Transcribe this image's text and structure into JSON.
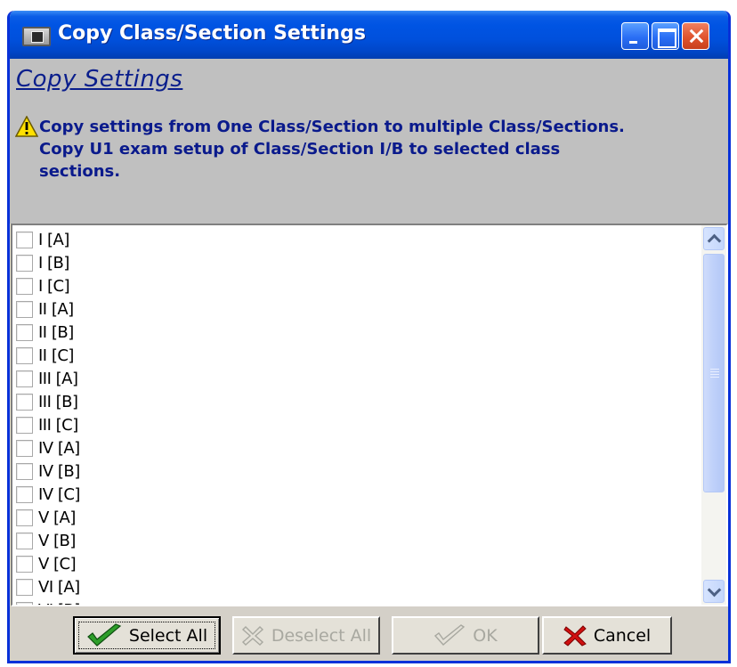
{
  "window": {
    "title": "Copy Class/Section Settings"
  },
  "header": {
    "heading": "Copy Settings",
    "message_lines": [
      "Copy settings from One Class/Section to multiple Class/Sections.",
      "Copy U1 exam setup of Class/Section I/B to selected class",
      "sections."
    ]
  },
  "list": {
    "items": [
      {
        "label": "I [A]",
        "checked": false
      },
      {
        "label": "I [B]",
        "checked": false
      },
      {
        "label": "I [C]",
        "checked": false
      },
      {
        "label": "II [A]",
        "checked": false
      },
      {
        "label": "II [B]",
        "checked": false
      },
      {
        "label": "II [C]",
        "checked": false
      },
      {
        "label": "III [A]",
        "checked": false
      },
      {
        "label": "III [B]",
        "checked": false
      },
      {
        "label": "III [C]",
        "checked": false
      },
      {
        "label": "IV [A]",
        "checked": false
      },
      {
        "label": "IV [B]",
        "checked": false
      },
      {
        "label": "IV [C]",
        "checked": false
      },
      {
        "label": "V [A]",
        "checked": false
      },
      {
        "label": "V [B]",
        "checked": false
      },
      {
        "label": "V [C]",
        "checked": false
      },
      {
        "label": "VI [A]",
        "checked": false
      },
      {
        "label": "VI [B]",
        "checked": false
      }
    ]
  },
  "buttons": {
    "select_all": "Select All",
    "deselect_all": "Deselect All",
    "ok": "OK",
    "cancel": "Cancel"
  },
  "icons": {
    "warning": "warning-icon",
    "select_all": "checkmark-icon",
    "deselect_all": "cross-outline-icon",
    "ok": "checkmark-outline-icon",
    "cancel": "red-x-icon"
  },
  "colors": {
    "title_bar": "#0054E3",
    "message_text": "#0A1A8C",
    "header_background": "#C0C0C0"
  }
}
